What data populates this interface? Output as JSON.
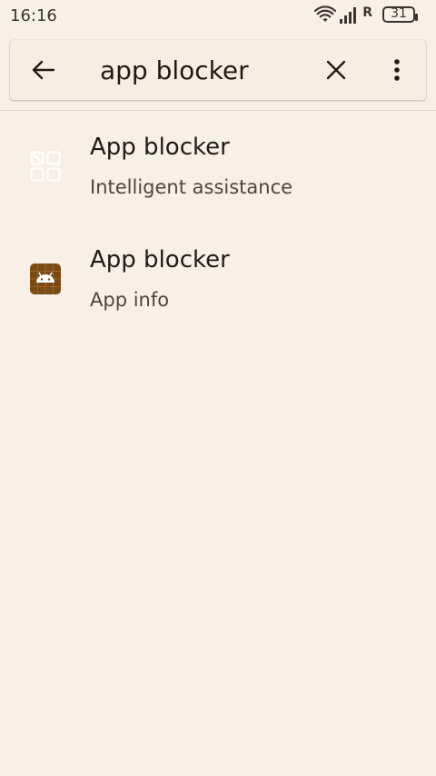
{
  "status_bar": {
    "time": "16:16",
    "roaming": "R",
    "battery": "31",
    "icons": [
      "wifi-icon",
      "signal-icon",
      "battery-icon"
    ]
  },
  "search": {
    "query": "app blocker",
    "icons": [
      "back-arrow-icon",
      "close-icon",
      "more-vert-icon"
    ]
  },
  "results": [
    {
      "title": "App blocker",
      "subtitle": "Intelligent assistance",
      "icon": "app-grid-block-icon"
    },
    {
      "title": "App blocker",
      "subtitle": "App info",
      "icon": "android-app-icon"
    }
  ],
  "colors": {
    "background": "#f8efe7",
    "search_bar": "#f8ede3",
    "text_primary": "#201a17",
    "text_secondary": "#52443c",
    "android_icon_bg": "#7a4a14"
  }
}
